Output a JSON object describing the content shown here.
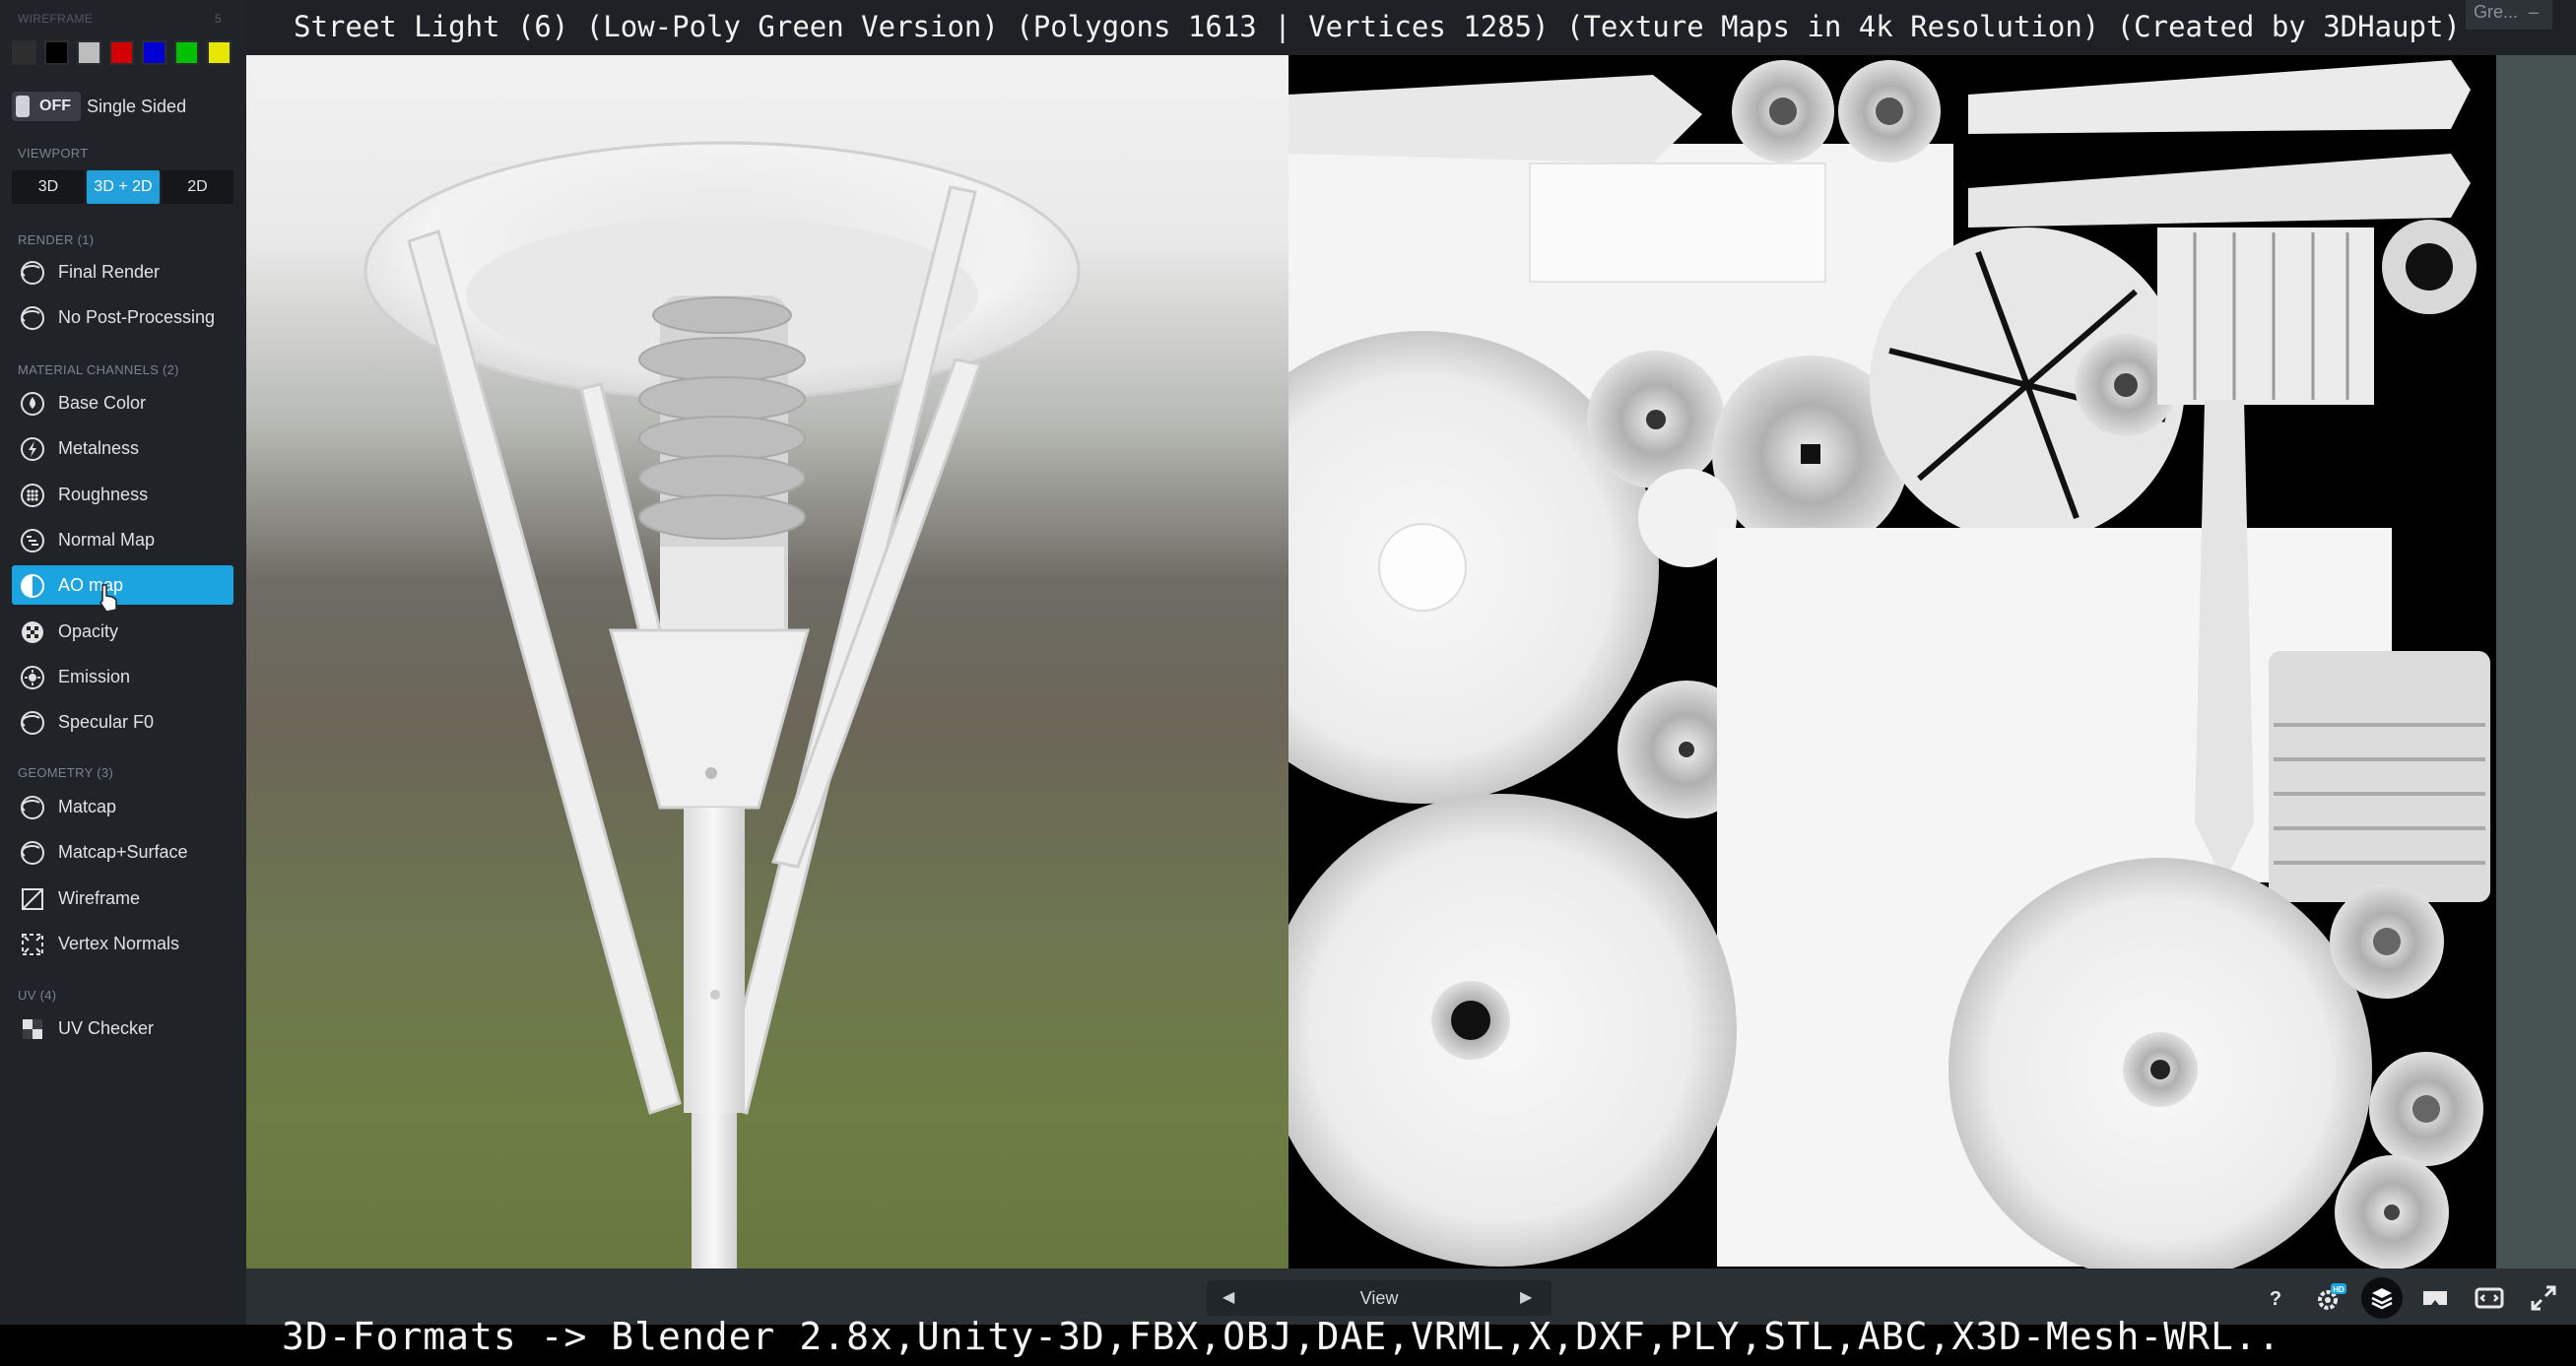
{
  "sidebar": {
    "wireframe_title": "WIREFRAME",
    "wireframe_count": "5",
    "swatch_colors": [
      "#2e2e2e",
      "#000000",
      "#bdbdbd",
      "#d40000",
      "#0000d4",
      "#00c000",
      "#e6e600"
    ],
    "single_sided": {
      "state": "OFF",
      "label": "Single Sided"
    },
    "viewport_title": "VIEWPORT",
    "viewport_modes": [
      "3D",
      "3D + 2D",
      "2D"
    ],
    "viewport_active": "3D + 2D",
    "render_title": "RENDER (1)",
    "render_items": [
      {
        "label": "Final Render",
        "icon": "sphere-icon"
      },
      {
        "label": "No Post-Processing",
        "icon": "sphere-icon"
      }
    ],
    "material_title": "MATERIAL CHANNELS (2)",
    "material_items": [
      {
        "label": "Base Color",
        "icon": "droplet-icon"
      },
      {
        "label": "Metalness",
        "icon": "lightning-icon"
      },
      {
        "label": "Roughness",
        "icon": "dots-icon"
      },
      {
        "label": "Normal Map",
        "icon": "normal-map-icon"
      },
      {
        "label": "AO map",
        "icon": "ao-icon",
        "active": true
      },
      {
        "label": "Opacity",
        "icon": "checker-circle-icon"
      },
      {
        "label": "Emission",
        "icon": "sun-icon"
      },
      {
        "label": "Specular F0",
        "icon": "sphere-icon"
      }
    ],
    "geometry_title": "GEOMETRY (3)",
    "geometry_items": [
      {
        "label": "Matcap",
        "icon": "sphere-icon"
      },
      {
        "label": "Matcap+Surface",
        "icon": "sphere-icon"
      },
      {
        "label": "Wireframe",
        "icon": "diagonal-line-icon"
      },
      {
        "label": "Vertex Normals",
        "icon": "expand-arrows-icon"
      }
    ],
    "uv_title": "UV (4)",
    "uv_items": [
      {
        "label": "UV Checker",
        "icon": "checker-icon"
      }
    ]
  },
  "viewport": {
    "title": "Street Light (6) (Low-Poly Green Version) (Polygons 1613 | Vertices 1285) (Texture Maps in 4k Resolution) (Created by 3DHaupt)",
    "preset": "Gre...",
    "view_label": "View",
    "tools": [
      "help-icon",
      "settings-hd-icon",
      "layers-icon",
      "vr-icon",
      "embed-icon",
      "fullscreen-icon"
    ],
    "hd_badge": "HD",
    "help": "?"
  },
  "caption": "3D-Formats -> Blender 2.8x,Unity-3D,FBX,OBJ,DAE,VRML,X,DXF,PLY,STL,ABC,X3D-Mesh-WRL.."
}
